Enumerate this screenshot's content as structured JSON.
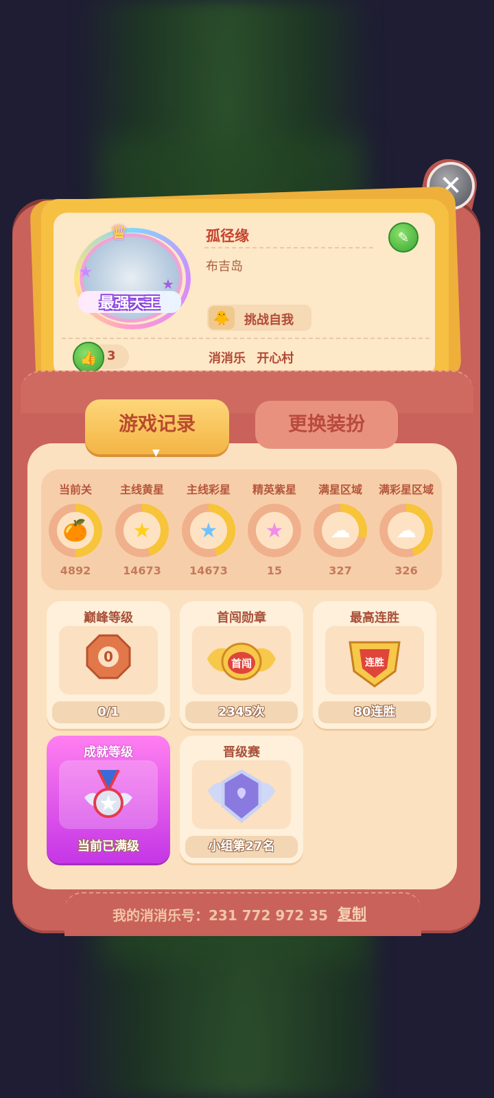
{
  "profile": {
    "avatar_label": "最强天王",
    "username": "孤径缘",
    "location": "布吉岛",
    "challenge_label": "挑战自我",
    "likes": "3",
    "group_primary": "消消乐",
    "group_secondary": "开心村"
  },
  "tabs": {
    "active": "游戏记录",
    "inactive": "更换装扮"
  },
  "stats": [
    {
      "label": "当前关",
      "value": "4892",
      "fill": 0.5,
      "icon": "fruit-icon"
    },
    {
      "label": "主线黄星",
      "value": "14673",
      "fill": 0.45,
      "icon": "yellow-star-icon"
    },
    {
      "label": "主线彩星",
      "value": "14673",
      "fill": 0.45,
      "icon": "rainbow-star-icon"
    },
    {
      "label": "精英紫星",
      "value": "15",
      "fill": 0.0,
      "icon": "purple-star-icon"
    },
    {
      "label": "满星区域",
      "value": "327",
      "fill": 0.3,
      "icon": "cloud-star-icon"
    },
    {
      "label": "满彩星区域",
      "value": "326",
      "fill": 0.45,
      "icon": "cloud-rainbow-icon"
    }
  ],
  "tiles": {
    "peak": {
      "title": "巅峰等级",
      "foot": "0/1",
      "badge": "0"
    },
    "first": {
      "title": "首闯勋章",
      "foot": "2345次",
      "badge": "首闯"
    },
    "streak": {
      "title": "最高连胜",
      "foot": "80连胜",
      "badge": "连胜"
    },
    "achievement": {
      "title": "成就等级",
      "foot": "当前已满级"
    },
    "promotion": {
      "title": "晋级赛",
      "foot": "小组第27名"
    }
  },
  "footer": {
    "uid_label": "我的消消乐号：231 772 972 35",
    "copy_label": "复制"
  },
  "colors": {
    "wallet": "#c9625a",
    "card_gold": "#f6c143",
    "ring_fill": "#f7c43a",
    "ring_track": "#f0b08c"
  }
}
